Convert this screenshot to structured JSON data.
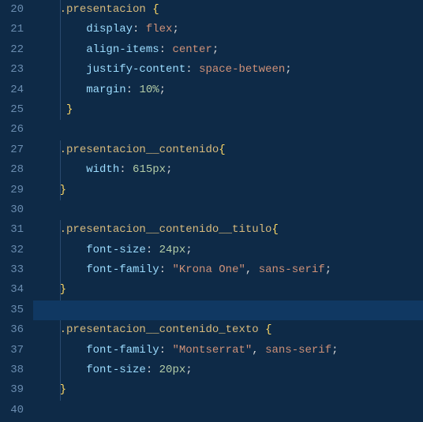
{
  "editor": {
    "startLine": 20,
    "lineCount": 21,
    "currentLine": 35,
    "indentGuideColumn": 4,
    "lines": [
      {
        "n": 20,
        "indent": 4,
        "tokens": [
          {
            "t": ".presentacion",
            "c": "selector"
          },
          {
            "t": " ",
            "c": "sep"
          },
          {
            "t": "{",
            "c": "punc"
          }
        ]
      },
      {
        "n": 21,
        "indent": 8,
        "tokens": [
          {
            "t": "display",
            "c": "prop"
          },
          {
            "t": ":",
            "c": "colon"
          },
          {
            "t": " ",
            "c": "sep"
          },
          {
            "t": "flex",
            "c": "value"
          },
          {
            "t": ";",
            "c": "sep"
          }
        ]
      },
      {
        "n": 22,
        "indent": 8,
        "tokens": [
          {
            "t": "align-items",
            "c": "prop"
          },
          {
            "t": ":",
            "c": "colon"
          },
          {
            "t": " ",
            "c": "sep"
          },
          {
            "t": "center",
            "c": "value"
          },
          {
            "t": ";",
            "c": "sep"
          }
        ]
      },
      {
        "n": 23,
        "indent": 8,
        "tokens": [
          {
            "t": "justify-content",
            "c": "prop"
          },
          {
            "t": ":",
            "c": "colon"
          },
          {
            "t": " ",
            "c": "sep"
          },
          {
            "t": "space-between",
            "c": "value"
          },
          {
            "t": ";",
            "c": "sep"
          }
        ]
      },
      {
        "n": 24,
        "indent": 8,
        "tokens": [
          {
            "t": "margin",
            "c": "prop"
          },
          {
            "t": ":",
            "c": "colon"
          },
          {
            "t": " ",
            "c": "sep"
          },
          {
            "t": "10%",
            "c": "number"
          },
          {
            "t": ";",
            "c": "sep"
          }
        ]
      },
      {
        "n": 25,
        "indent": 5,
        "tokens": [
          {
            "t": "}",
            "c": "punc"
          }
        ]
      },
      {
        "n": 26,
        "indent": 0,
        "tokens": []
      },
      {
        "n": 27,
        "indent": 4,
        "tokens": [
          {
            "t": ".presentacion__contenido",
            "c": "selector"
          },
          {
            "t": "{",
            "c": "punc"
          }
        ]
      },
      {
        "n": 28,
        "indent": 8,
        "tokens": [
          {
            "t": "width",
            "c": "prop"
          },
          {
            "t": ":",
            "c": "colon"
          },
          {
            "t": " ",
            "c": "sep"
          },
          {
            "t": "615px",
            "c": "number"
          },
          {
            "t": ";",
            "c": "sep"
          }
        ]
      },
      {
        "n": 29,
        "indent": 4,
        "tokens": [
          {
            "t": "}",
            "c": "punc"
          }
        ]
      },
      {
        "n": 30,
        "indent": 0,
        "tokens": []
      },
      {
        "n": 31,
        "indent": 4,
        "tokens": [
          {
            "t": ".presentacion__contenido__titulo",
            "c": "selector"
          },
          {
            "t": "{",
            "c": "punc"
          }
        ]
      },
      {
        "n": 32,
        "indent": 8,
        "tokens": [
          {
            "t": "font-size",
            "c": "prop"
          },
          {
            "t": ":",
            "c": "colon"
          },
          {
            "t": " ",
            "c": "sep"
          },
          {
            "t": "24px",
            "c": "number"
          },
          {
            "t": ";",
            "c": "sep"
          }
        ]
      },
      {
        "n": 33,
        "indent": 8,
        "tokens": [
          {
            "t": "font-family",
            "c": "prop"
          },
          {
            "t": ":",
            "c": "colon"
          },
          {
            "t": " ",
            "c": "sep"
          },
          {
            "t": "\"Krona One\"",
            "c": "value"
          },
          {
            "t": ",",
            "c": "sep"
          },
          {
            "t": " ",
            "c": "sep"
          },
          {
            "t": "sans-serif",
            "c": "value"
          },
          {
            "t": ";",
            "c": "sep"
          }
        ]
      },
      {
        "n": 34,
        "indent": 4,
        "tokens": [
          {
            "t": "}",
            "c": "punc"
          }
        ]
      },
      {
        "n": 35,
        "indent": 0,
        "tokens": []
      },
      {
        "n": 36,
        "indent": 4,
        "tokens": [
          {
            "t": ".presentacion__contenido_texto",
            "c": "selector"
          },
          {
            "t": " ",
            "c": "sep"
          },
          {
            "t": "{",
            "c": "punc"
          }
        ]
      },
      {
        "n": 37,
        "indent": 8,
        "tokens": [
          {
            "t": "font-family",
            "c": "prop"
          },
          {
            "t": ":",
            "c": "colon"
          },
          {
            "t": " ",
            "c": "sep"
          },
          {
            "t": "\"Montserrat\"",
            "c": "value"
          },
          {
            "t": ",",
            "c": "sep"
          },
          {
            "t": " ",
            "c": "sep"
          },
          {
            "t": "sans-serif",
            "c": "value"
          },
          {
            "t": ";",
            "c": "sep"
          }
        ]
      },
      {
        "n": 38,
        "indent": 8,
        "tokens": [
          {
            "t": "font-size",
            "c": "prop"
          },
          {
            "t": ":",
            "c": "colon"
          },
          {
            "t": " ",
            "c": "sep"
          },
          {
            "t": "20px",
            "c": "number"
          },
          {
            "t": ";",
            "c": "sep"
          }
        ]
      },
      {
        "n": 39,
        "indent": 4,
        "tokens": [
          {
            "t": "}",
            "c": "punc"
          }
        ]
      },
      {
        "n": 40,
        "indent": 0,
        "tokens": []
      }
    ]
  }
}
